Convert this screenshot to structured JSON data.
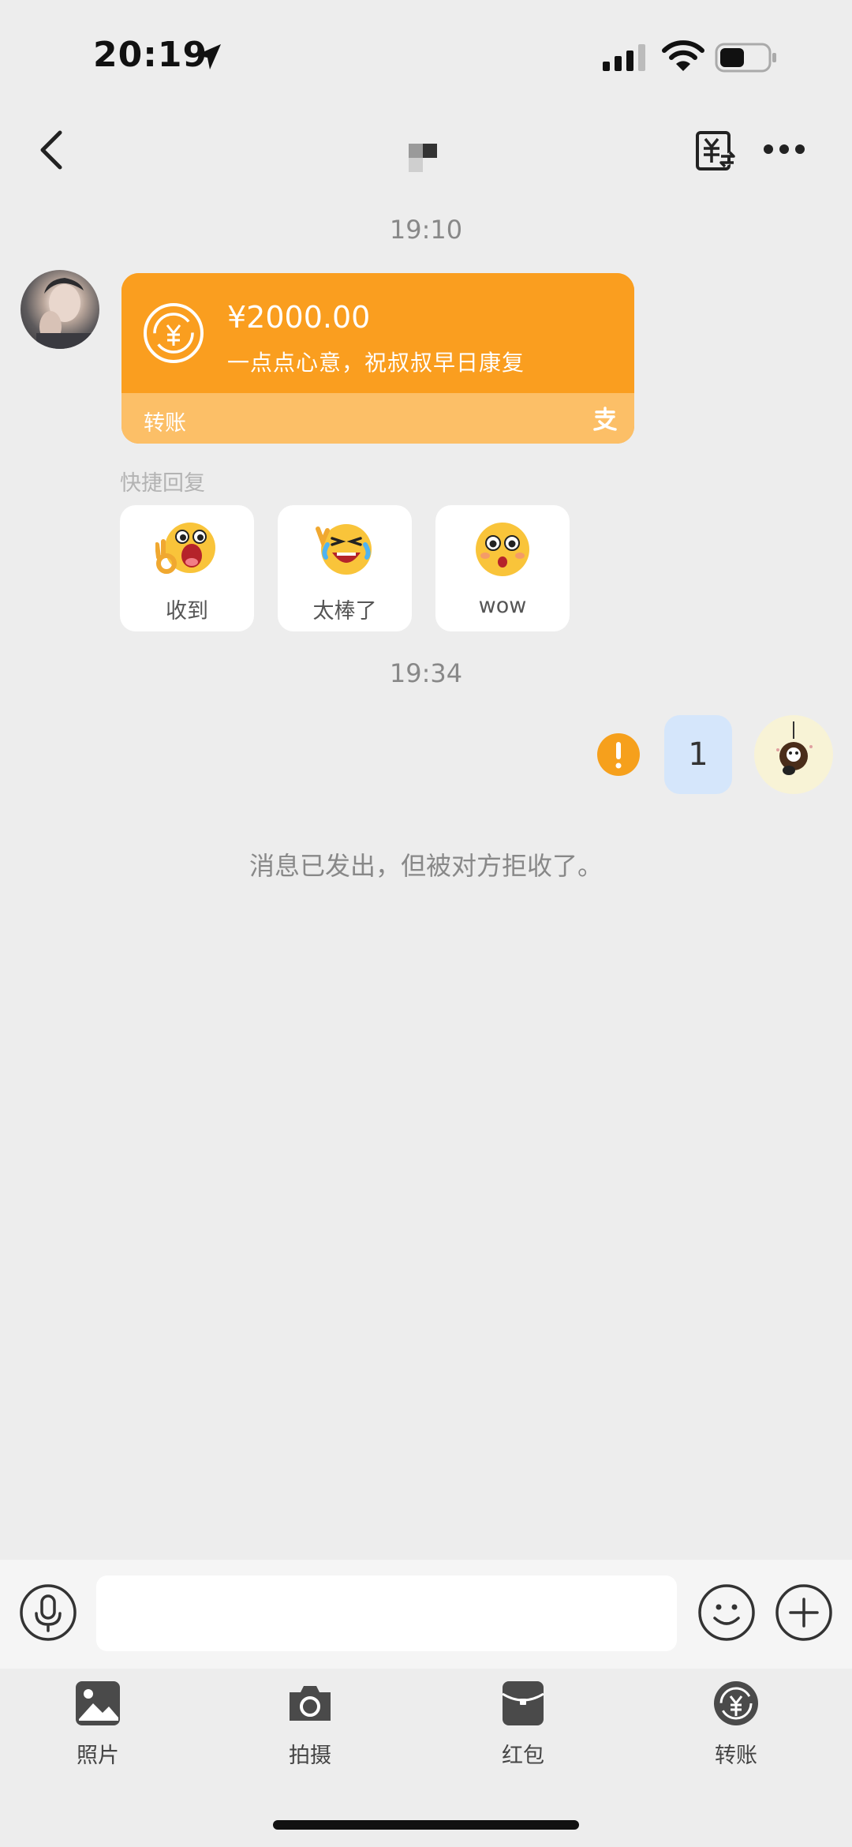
{
  "status_bar": {
    "time": "20:19"
  },
  "timestamps": {
    "first": "19:10",
    "second": "19:34"
  },
  "transfer_card": {
    "amount": "¥2000.00",
    "note": "一点点心意，祝叔叔早日康复",
    "label": "转账",
    "accent_color": "#fa9e1f"
  },
  "quick_reply": {
    "title": "快捷回复",
    "items": [
      {
        "label": "收到",
        "icon": "ok-hand-emoji-icon"
      },
      {
        "label": "太棒了",
        "icon": "laughing-emoji-icon"
      },
      {
        "label": "wow",
        "icon": "surprised-emoji-icon"
      }
    ]
  },
  "sent_message": {
    "text": "1",
    "status": "error"
  },
  "rejected_note": "消息已发出，但被对方拒收了。",
  "input": {
    "placeholder": ""
  },
  "toolbar": {
    "items": [
      {
        "label": "照片",
        "icon": "photo-icon"
      },
      {
        "label": "拍摄",
        "icon": "camera-icon"
      },
      {
        "label": "红包",
        "icon": "red-envelope-icon"
      },
      {
        "label": "转账",
        "icon": "transfer-icon"
      }
    ]
  }
}
